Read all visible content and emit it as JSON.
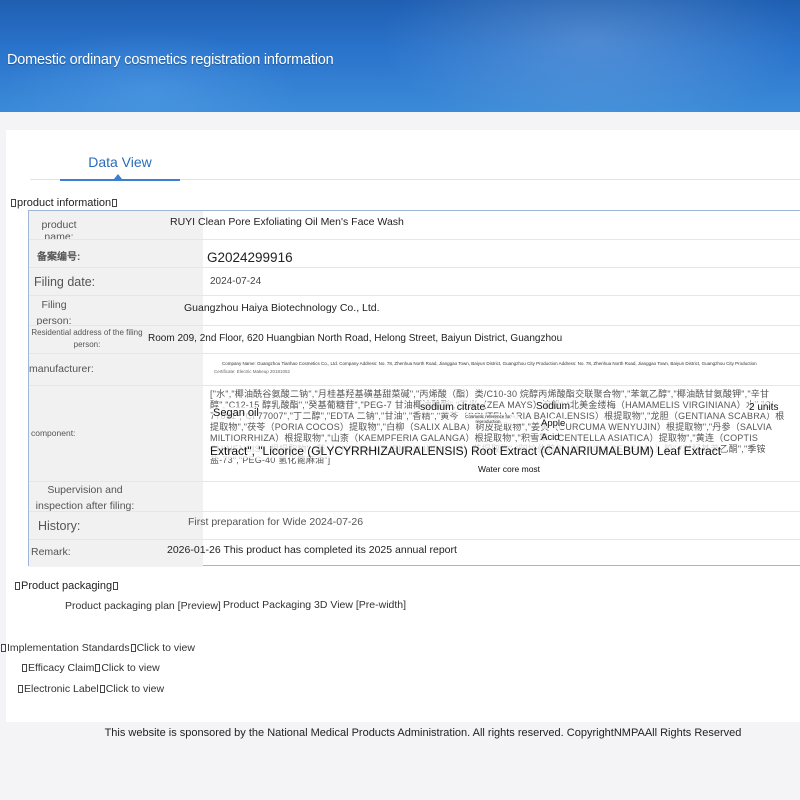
{
  "banner": {
    "title": "Domestic ordinary cosmetics registration information"
  },
  "tabs": [
    {
      "label": "Data View"
    }
  ],
  "product_information": {
    "heading": "product information"
  },
  "fields": {
    "product_name": {
      "label": "product name:",
      "value": "RUYI Clean Pore Exfoliating Oil Men's Face Wash"
    },
    "record_number": {
      "label": "备案编号:",
      "value": "G2024299916"
    },
    "filing_date": {
      "label": "Filing date:",
      "value": "2024-07-24"
    },
    "filing_person": {
      "label": "Filing person:",
      "value": "Guangzhou Haiya Biotechnology Co., Ltd."
    },
    "residential_address": {
      "label": "Residential address of the filing person:",
      "value": "Room 209, 2nd Floor, 620 Huangbian North Road, Helong Street, Baiyun District, Guangzhou"
    },
    "manufacturer": {
      "label": "manufacturer:",
      "value": "Company Name: Guangzhou Tianhao Cosmetics Co., Ltd. Company Address: No. 78, Zhenhua North Road, Jianggao Town, Baiyun District, Guangzhou City Production Address: No. 78, Zhenhua North Road, Jianggao Town, Baiyun District, Guangzhou City Production",
      "subvalue": "Certificate: Electric Makeup 20181052"
    },
    "component": {
      "label": "component:",
      "value": "[\"水\",\"椰油酰谷氨酸二钠\",\"月桂基羟基磺基甜菜碱\",\"丙烯酸（酯）类/C10-30 烷醇丙烯酸酯交联聚合物\",\"苯氧乙醇\",\"椰油酰甘氨酸钾\",\"辛甘醇\",\"C12-15 醇乳酸酯\",\"癸基葡糖苷\",\"PEG-7 甘油椰油酸酯\",\"玉米（ZEA MAYS）淀粉\",\"北美金缕梅（HAMAMELIS VIRGINIANA）水\",\"CI 77891\",\"CI 77007\",\"丁二醇\",\"EDTA 二钠\",\"甘油\",\"香精\",\"黄芩（SCUTELLARIA BAICALENSIS）根提取物\",\"龙胆（GENTIANA SCABRA）根提取物\",\"茯苓（PORIA COCOS）提取物\",\"白柳（SALIX ALBA）树皮提取物\",\"姜黄（CURCUMA WENYUJIN）根提取物\",\"丹参（SALVIA MILTIORRHIZA）根提取物\",\"山柰（KAEMPFERIA GALANGA）根提取物\",\"积雪草（CENTELLA ASIATICA）提取物\",\"黄连（COPTIS CHINENSIS）根提取物\",\"菊（CHRYSANTHEMUM INDICUM）花提取物\",\"阿拉伯胶树（ACACIA SENEGAL）胶\",\"对羟基苯乙酮\",\"季铵盐-73\",\"PEG-40 氢化蓖麻油\"]",
      "overlays": {
        "segan_oil": "Segan oil",
        "sodium_citrate": "sodium citrate",
        "sodium": "Sodium",
        "units": "2 units",
        "reference": "Cosmetic reference for reproduction",
        "apple": "Apple",
        "acid": "Acid",
        "extract_line": "Extract\", \"Licorice (GLYCYRRHIZAURALENSIS) Root Extract (CANARIUMALBUM) Leaf Extract",
        "water_core": "Water core most"
      }
    },
    "supervision": {
      "label": "Supervision and inspection after filing:",
      "value": ""
    },
    "history": {
      "label": "History:",
      "value": "First preparation for Wide 2024-07-26"
    },
    "remark": {
      "label": "Remark:",
      "value": "2026-01-26 This product has completed its 2025 annual report"
    }
  },
  "product_packaging": {
    "heading": "Product packaging",
    "plan_link": "Product packaging plan [Preview]",
    "view3d_link": "Product Packaging 3D View [Pre-width]"
  },
  "links": {
    "implementation": {
      "label": "Implementation Standards",
      "action": "Click to view"
    },
    "efficacy": {
      "label": "Efficacy Claim",
      "action": "Click to view"
    },
    "electronic": {
      "label": "Electronic Label",
      "action": "Click to view"
    }
  },
  "footer": {
    "text": "This website is sponsored by the National Medical Products Administration. All rights reserved. CopyrightNMPAAll Rights Reserved"
  },
  "colors": {
    "banner": "#2a74cc",
    "accent": "#2b6cb8",
    "table_border": "#9fb6da"
  }
}
